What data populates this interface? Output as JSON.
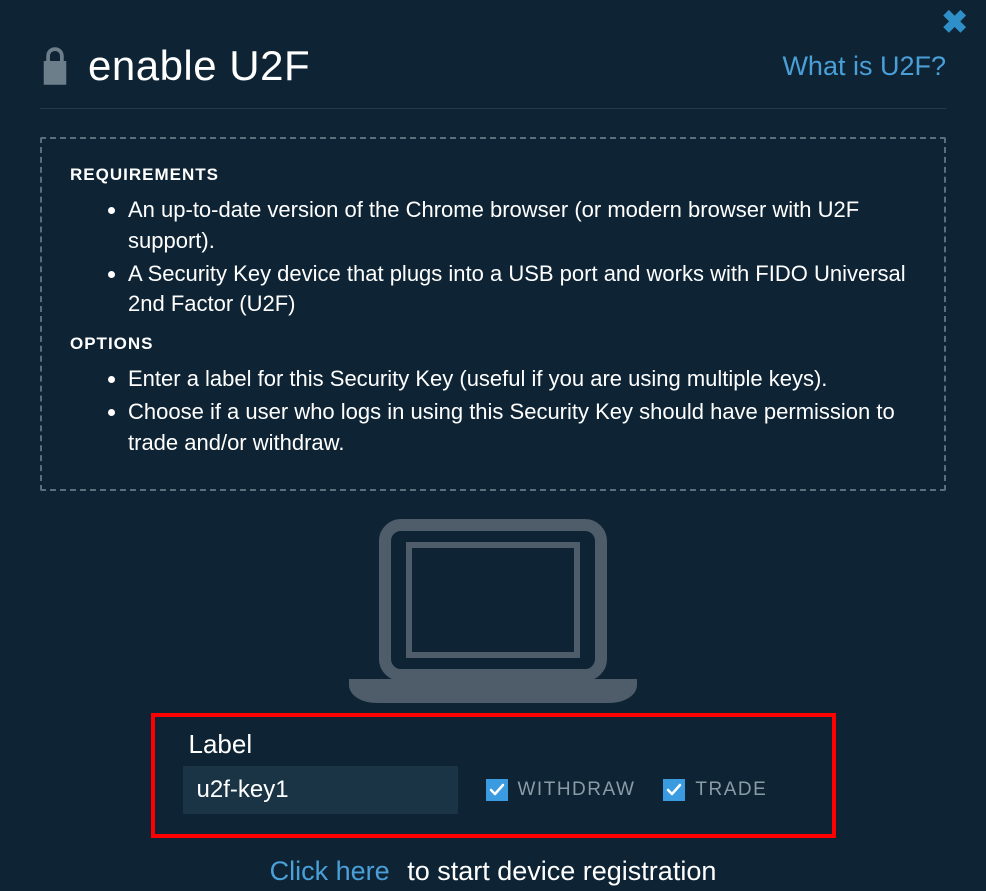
{
  "close_glyph": "✖",
  "header": {
    "title": "enable U2F",
    "help_link": "What is U2F?"
  },
  "requirements": {
    "heading": "REQUIREMENTS",
    "items": [
      "An up-to-date version of the Chrome browser (or modern browser with U2F support).",
      "A Security Key device that plugs into a USB port and works with FIDO Universal 2nd Factor (U2F)"
    ]
  },
  "options": {
    "heading": "OPTIONS",
    "items": [
      "Enter a label for this Security Key (useful if you are using multiple keys).",
      "Choose if a user who logs in using this Security Key should have permission to trade and/or withdraw."
    ]
  },
  "form": {
    "label_heading": "Label",
    "label_value": "u2f-key1",
    "withdraw_label": "WITHDRAW",
    "withdraw_checked": true,
    "trade_label": "TRADE",
    "trade_checked": true
  },
  "cta": {
    "link_text": "Click here",
    "rest_text": "to start device registration"
  }
}
